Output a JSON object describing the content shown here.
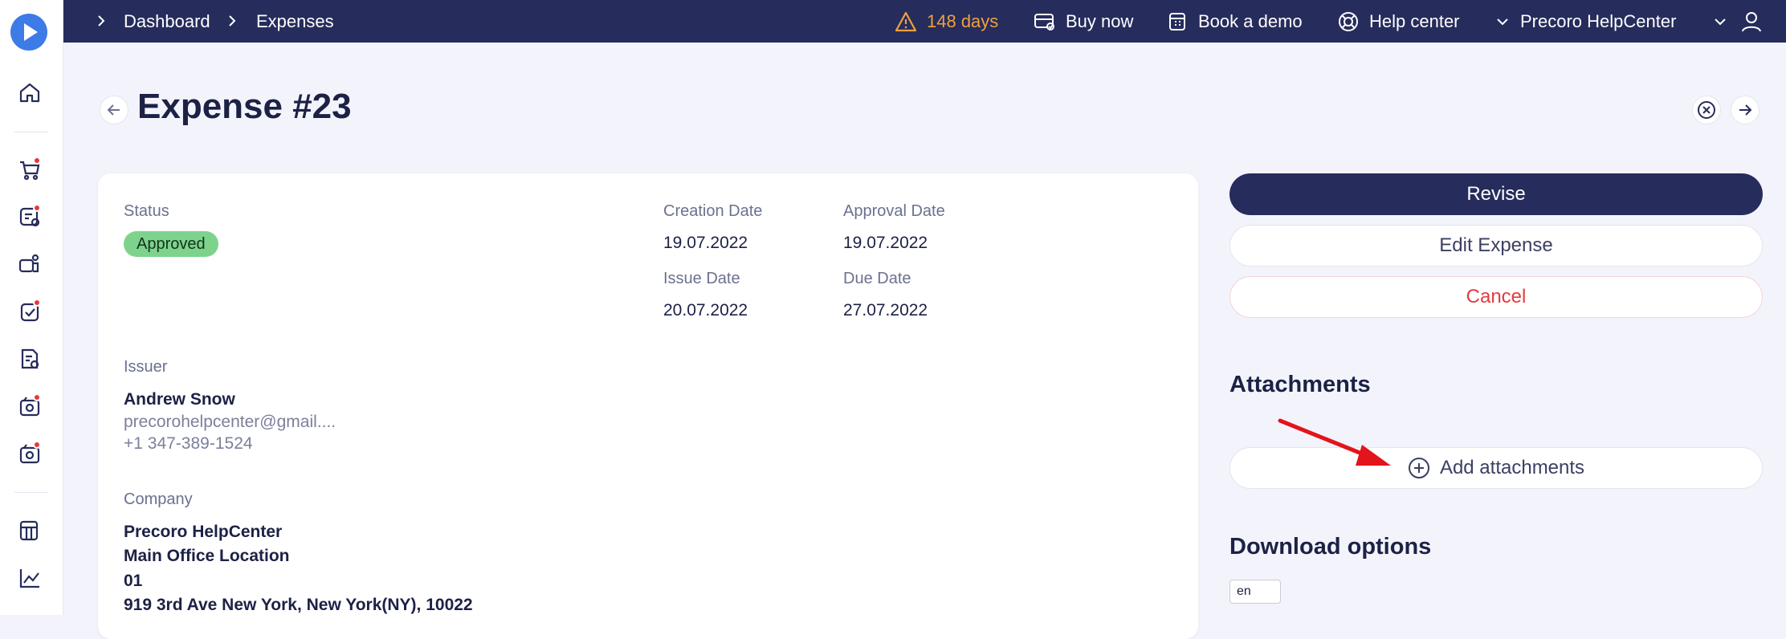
{
  "topbar": {
    "breadcrumb": [
      "Dashboard",
      "Expenses"
    ],
    "trial": "148 days",
    "buy_now": "Buy now",
    "book_demo": "Book a demo",
    "help_center": "Help center",
    "company": "Precoro HelpCenter"
  },
  "page": {
    "title": "Expense #23"
  },
  "details": {
    "status_label": "Status",
    "status_value": "Approved",
    "creation_date_label": "Creation Date",
    "creation_date": "19.07.2022",
    "approval_date_label": "Approval Date",
    "approval_date": "19.07.2022",
    "issue_date_label": "Issue Date",
    "issue_date": "20.07.2022",
    "due_date_label": "Due Date",
    "due_date": "27.07.2022",
    "issuer_label": "Issuer",
    "issuer_name": "Andrew Snow",
    "issuer_email": "precorohelpcenter@gmail....",
    "issuer_phone": "+1 347-389-1524",
    "company_label": "Company",
    "company_lines": [
      "Precoro HelpCenter",
      "Main Office Location",
      "01",
      "919 3rd Ave New York, New York(NY), 10022"
    ]
  },
  "actions": {
    "revise": "Revise",
    "edit": "Edit Expense",
    "cancel": "Cancel"
  },
  "attachments": {
    "title": "Attachments",
    "add_label": "Add attachments"
  },
  "download": {
    "title": "Download options",
    "language": "en"
  },
  "colors": {
    "topbar": "#262c5c",
    "accent": "#3d7be6",
    "badge": "#7dd38c",
    "danger": "#e33b3f",
    "warning": "#f0a03c",
    "arrow": "#e4141b"
  }
}
